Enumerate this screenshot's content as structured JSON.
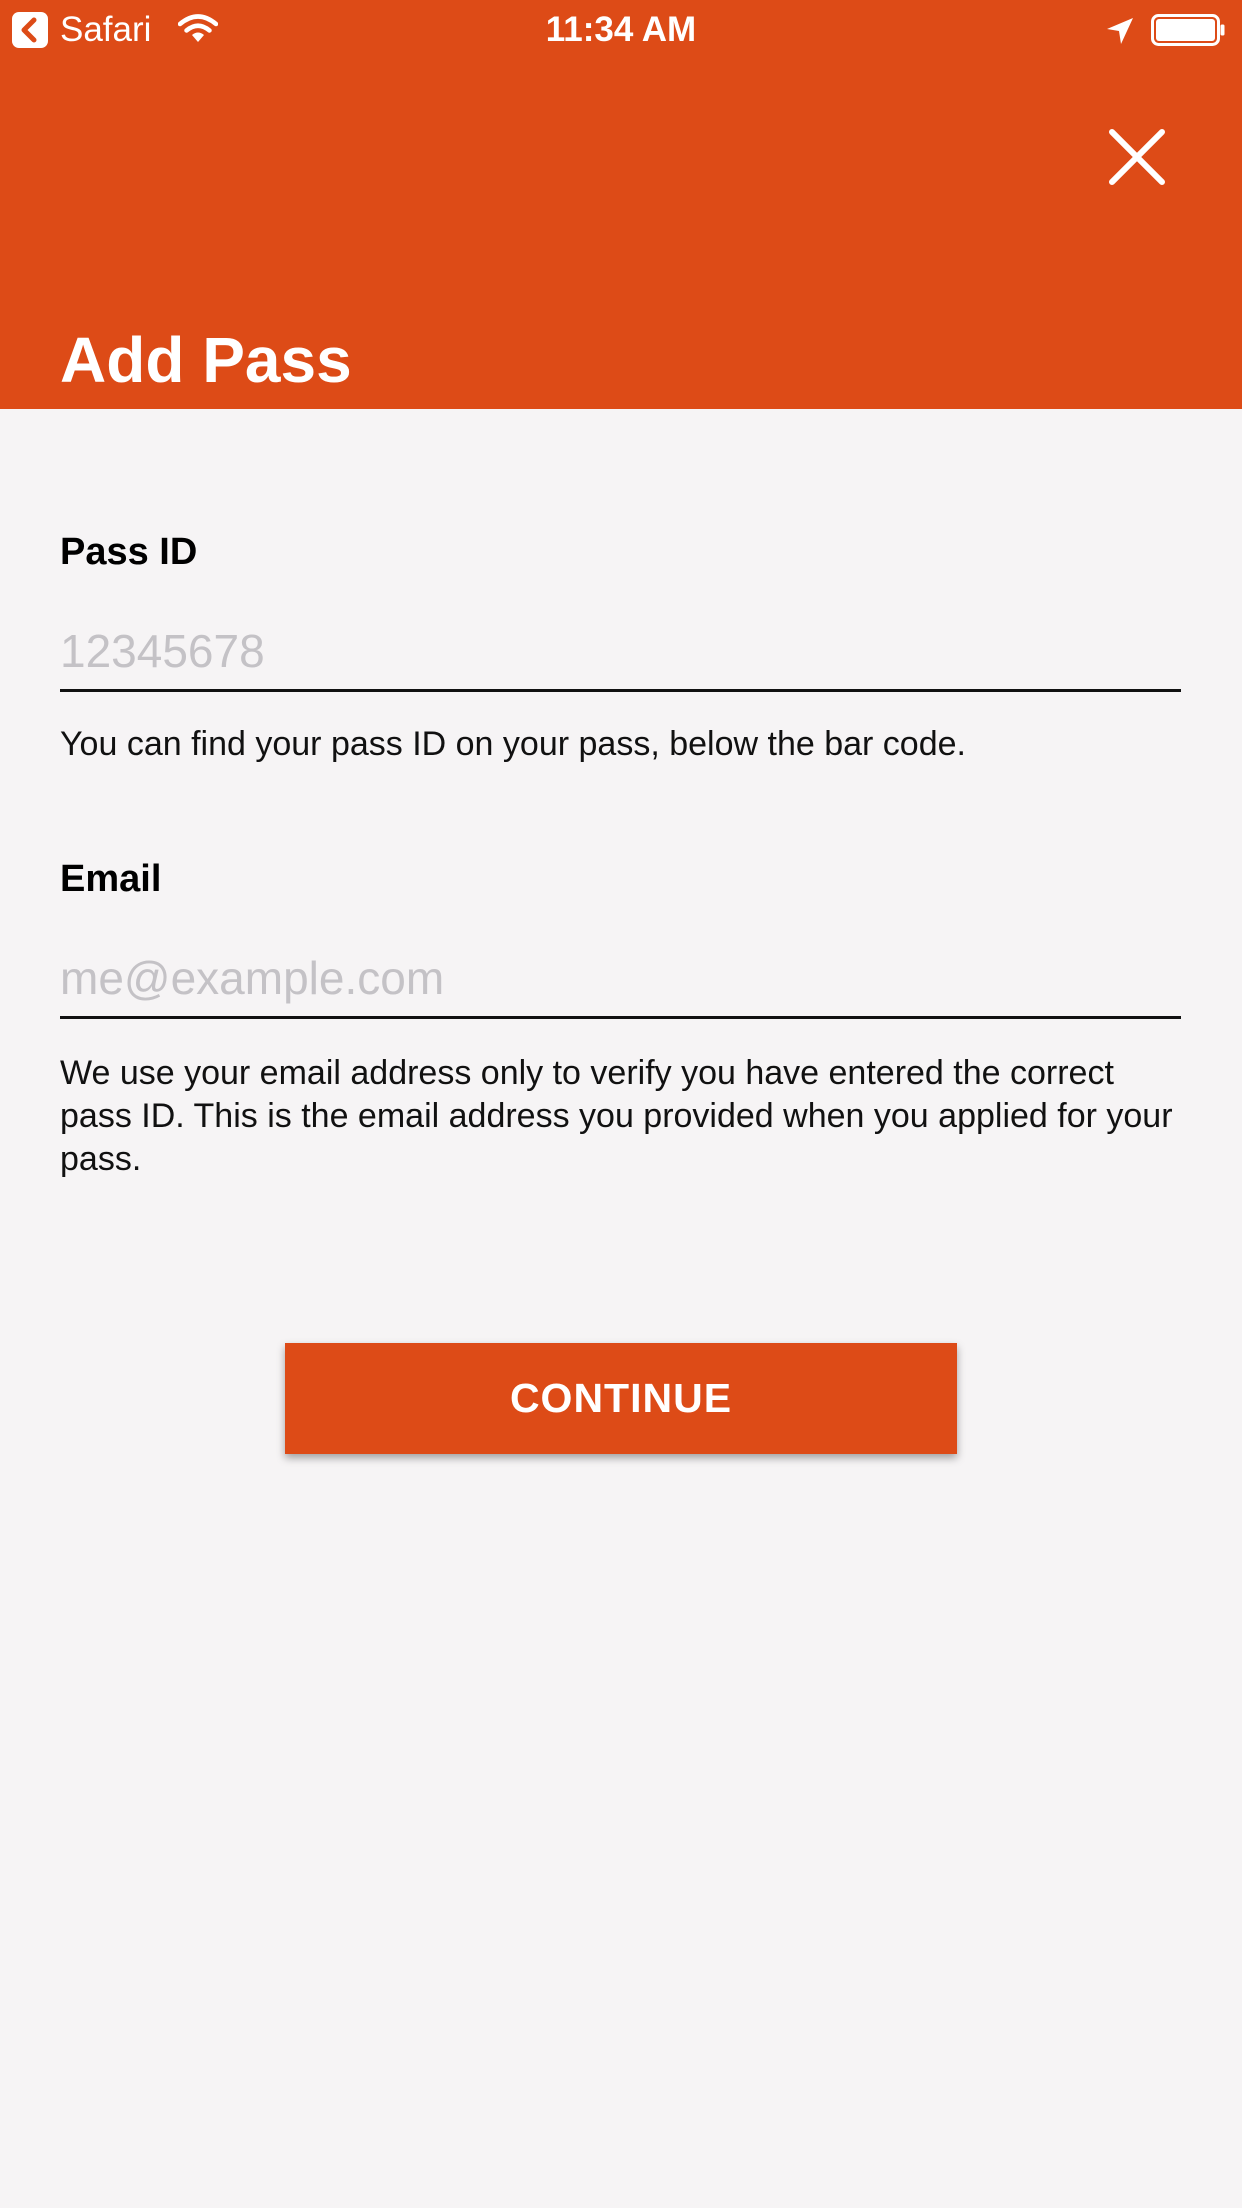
{
  "status_bar": {
    "back_app": "Safari",
    "time": "11:34 AM"
  },
  "header": {
    "title": "Add Pass",
    "background_color": "#dd4b17",
    "close_icon": "close-icon"
  },
  "form": {
    "pass_id": {
      "label": "Pass ID",
      "value": "",
      "placeholder": "12345678",
      "help": "You can find your pass ID on your pass, below the bar code."
    },
    "email": {
      "label": "Email",
      "value": "",
      "placeholder": "me@example.com",
      "help": "We use your email address only to verify you have entered the correct pass ID. This is the email address you provided when you applied for your pass."
    }
  },
  "actions": {
    "continue_label": "CONTINUE"
  }
}
